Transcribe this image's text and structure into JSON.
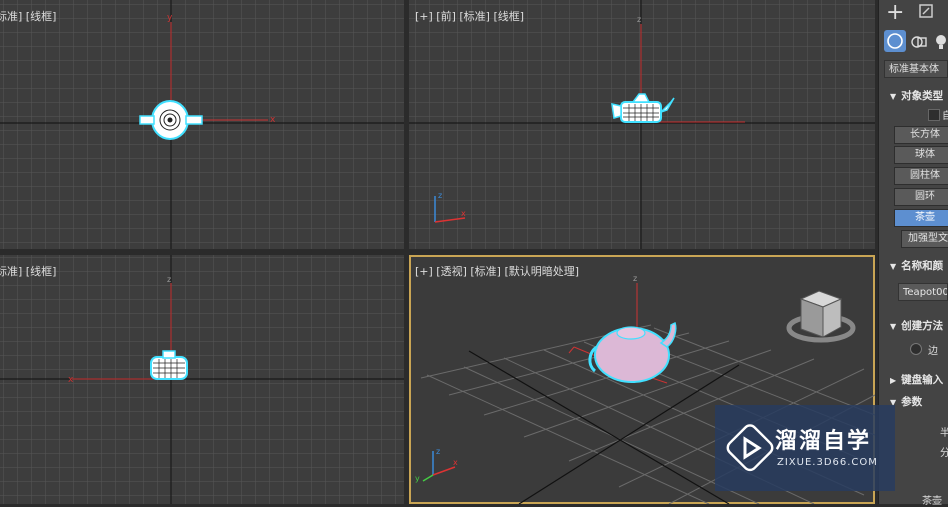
{
  "viewports": {
    "top": {
      "label": "标准] [线框]"
    },
    "front": {
      "label": "[+] [前] [标准] [线框]"
    },
    "left": {
      "label": "标准] [线框]"
    },
    "perspective": {
      "label": "[+] [透视] [标准] [默认明暗处理]"
    }
  },
  "axis_letters": {
    "x": "x",
    "y": "y",
    "z": "z"
  },
  "command_panel": {
    "category_dropdown": "标准基本体",
    "object_type_header": "对象类型",
    "autogrid_label": "自",
    "buttons": [
      {
        "label": "长方体",
        "active": false
      },
      {
        "label": "球体",
        "active": false
      },
      {
        "label": "圆柱体",
        "active": false
      },
      {
        "label": "圆环",
        "active": false
      },
      {
        "label": "茶壶",
        "active": true
      },
      {
        "label": "加强型文",
        "active": false
      }
    ],
    "name_color_header": "名称和颜",
    "object_name": "Teapot00",
    "creation_method_header": "创建方法",
    "creation_method_option": "边",
    "keyboard_entry_header": "键盘输入",
    "parameters_header": "参数",
    "param_labels": [
      "半",
      "分"
    ],
    "bottom_text": "茶壶"
  },
  "watermark": {
    "title": "溜溜自学",
    "subtitle": "ZIXUE.3D66.COM"
  },
  "colors": {
    "grid": "#575757",
    "axis_dark": "#1a1a1a",
    "selection": "#41e0ff",
    "active_button": "#5d8fd0",
    "viewport_border": "#c9a554"
  }
}
